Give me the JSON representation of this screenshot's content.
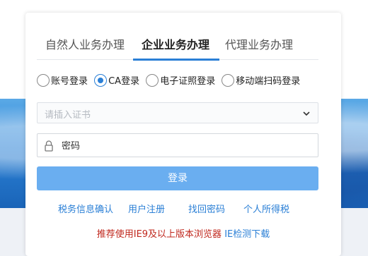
{
  "tabs": [
    {
      "label": "自然人业务办理",
      "active": false
    },
    {
      "label": "企业业务办理",
      "active": true
    },
    {
      "label": "代理业务办理",
      "active": false
    }
  ],
  "login_methods": [
    {
      "label": "账号登录",
      "checked": false
    },
    {
      "label": "CA登录",
      "checked": true
    },
    {
      "label": "电子证照登录",
      "checked": false
    },
    {
      "label": "移动端扫码登录",
      "checked": false
    }
  ],
  "certificate_select": {
    "placeholder": "请插入证书",
    "icon": "chevron-down-icon"
  },
  "password": {
    "placeholder": "密码",
    "icon": "lock-icon"
  },
  "login_button": {
    "label": "登录"
  },
  "links": [
    {
      "label": "税务信息确认"
    },
    {
      "label": "用户注册"
    },
    {
      "label": "找回密码"
    },
    {
      "label": "个人所得税"
    }
  ],
  "notice": {
    "recommendation": "推荐使用IE9及以上版本浏览器",
    "ie_check_download": "IE检测下载"
  },
  "colors": {
    "accent": "#2a7fd6",
    "button": "#6aaef0",
    "notice_red": "#c0281e"
  }
}
